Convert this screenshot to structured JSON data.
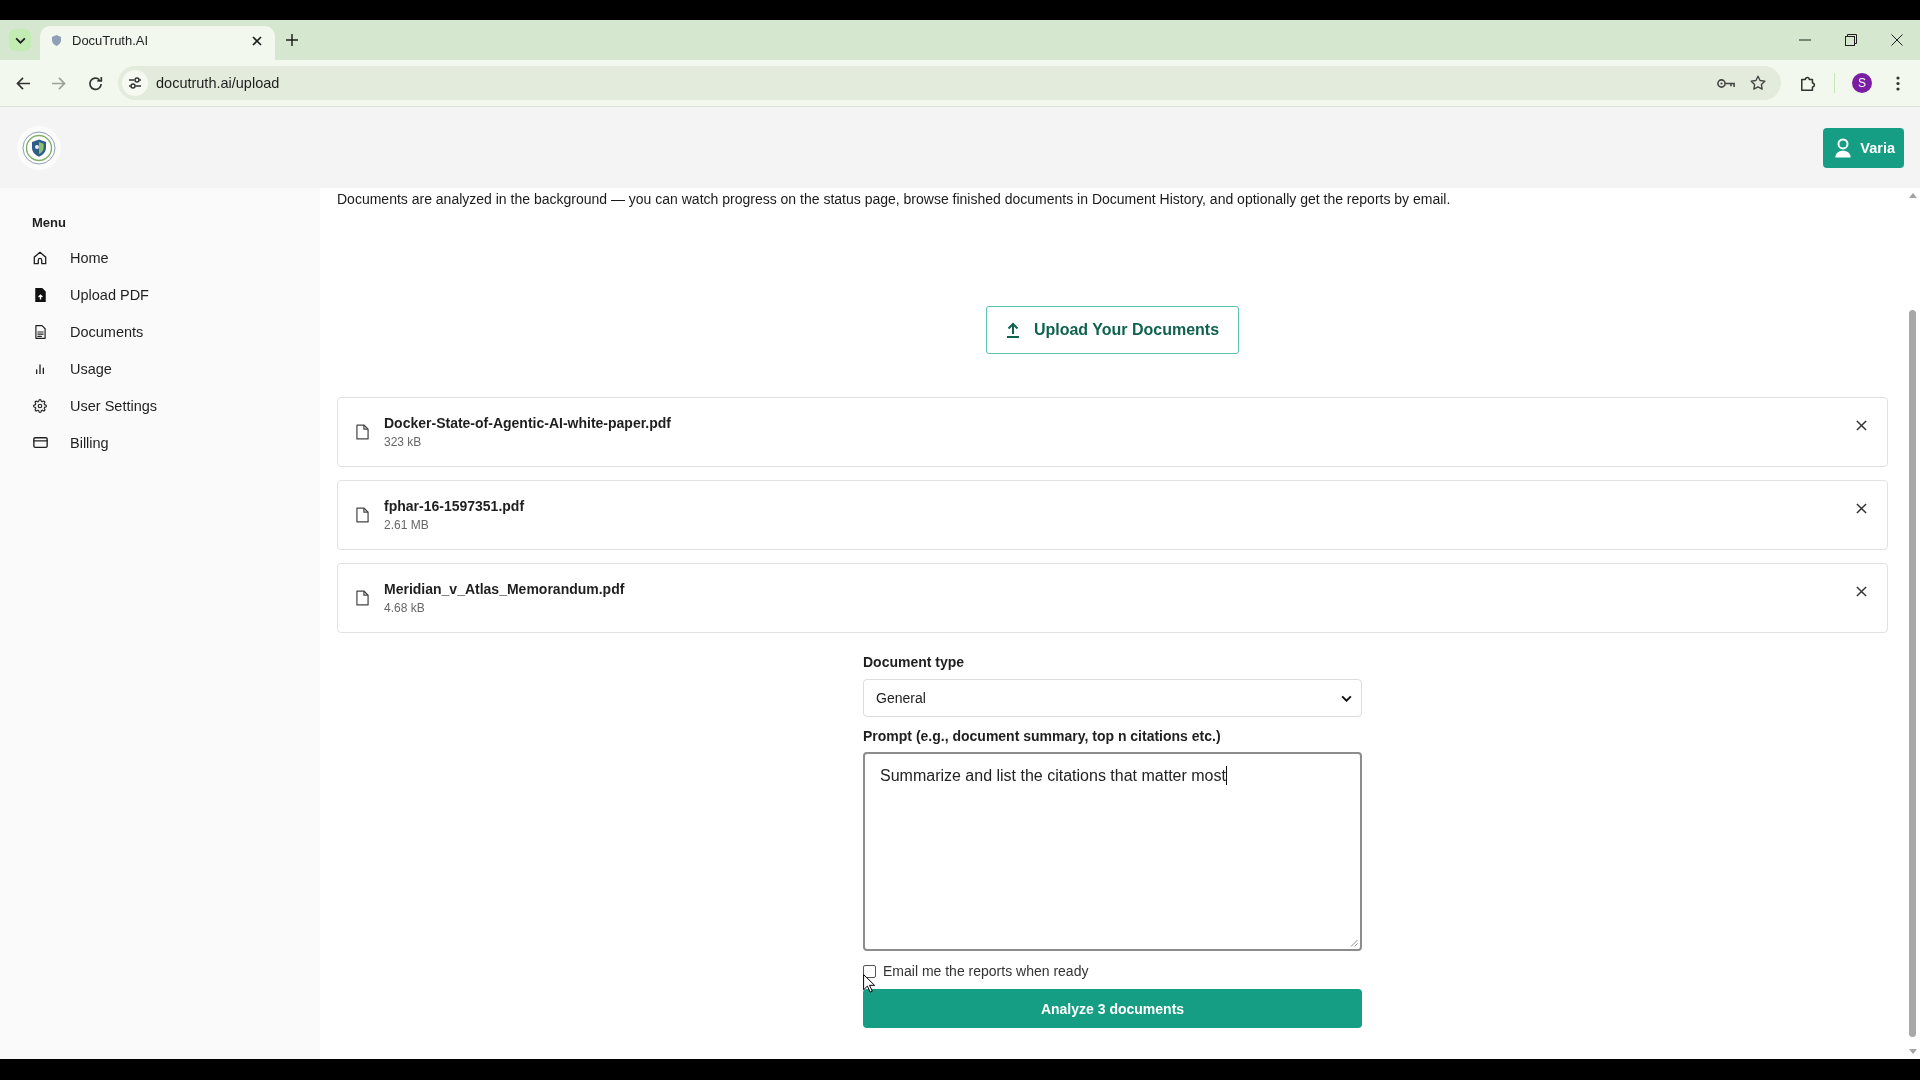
{
  "browser": {
    "tabs": [
      {
        "title": "DocuTruth.AI",
        "selected": true
      }
    ],
    "url": "docutruth.ai/upload",
    "profile": "S"
  },
  "header": {
    "user_button": "Varia"
  },
  "sidebar": {
    "heading": "Menu",
    "items": [
      {
        "label": "Home"
      },
      {
        "label": "Upload PDF"
      },
      {
        "label": "Documents"
      },
      {
        "label": "Usage"
      },
      {
        "label": "User Settings"
      },
      {
        "label": "Billing"
      }
    ]
  },
  "intro": "Documents are analyzed in the background — you can watch progress on the status page, browse finished documents in Document History, and optionally get the reports by email.",
  "upload_button": "Upload Your Documents",
  "files": [
    {
      "name": "Docker-State-of-Agentic-AI-white-paper.pdf",
      "size": "323 kB"
    },
    {
      "name": "fphar-16-1597351.pdf",
      "size": "2.61 MB"
    },
    {
      "name": "Meridian_v_Atlas_Memorandum.pdf",
      "size": "4.68 kB"
    }
  ],
  "form": {
    "document_type": {
      "label": "Document type",
      "value": "General"
    },
    "prompt": {
      "label": "Prompt (e.g., document summary, top n citations etc.)",
      "value": "Summarize and list the citations that matter most"
    },
    "email": {
      "label": "Email me the reports when ready",
      "checked": false
    },
    "submit": "Analyze 3 documents"
  }
}
